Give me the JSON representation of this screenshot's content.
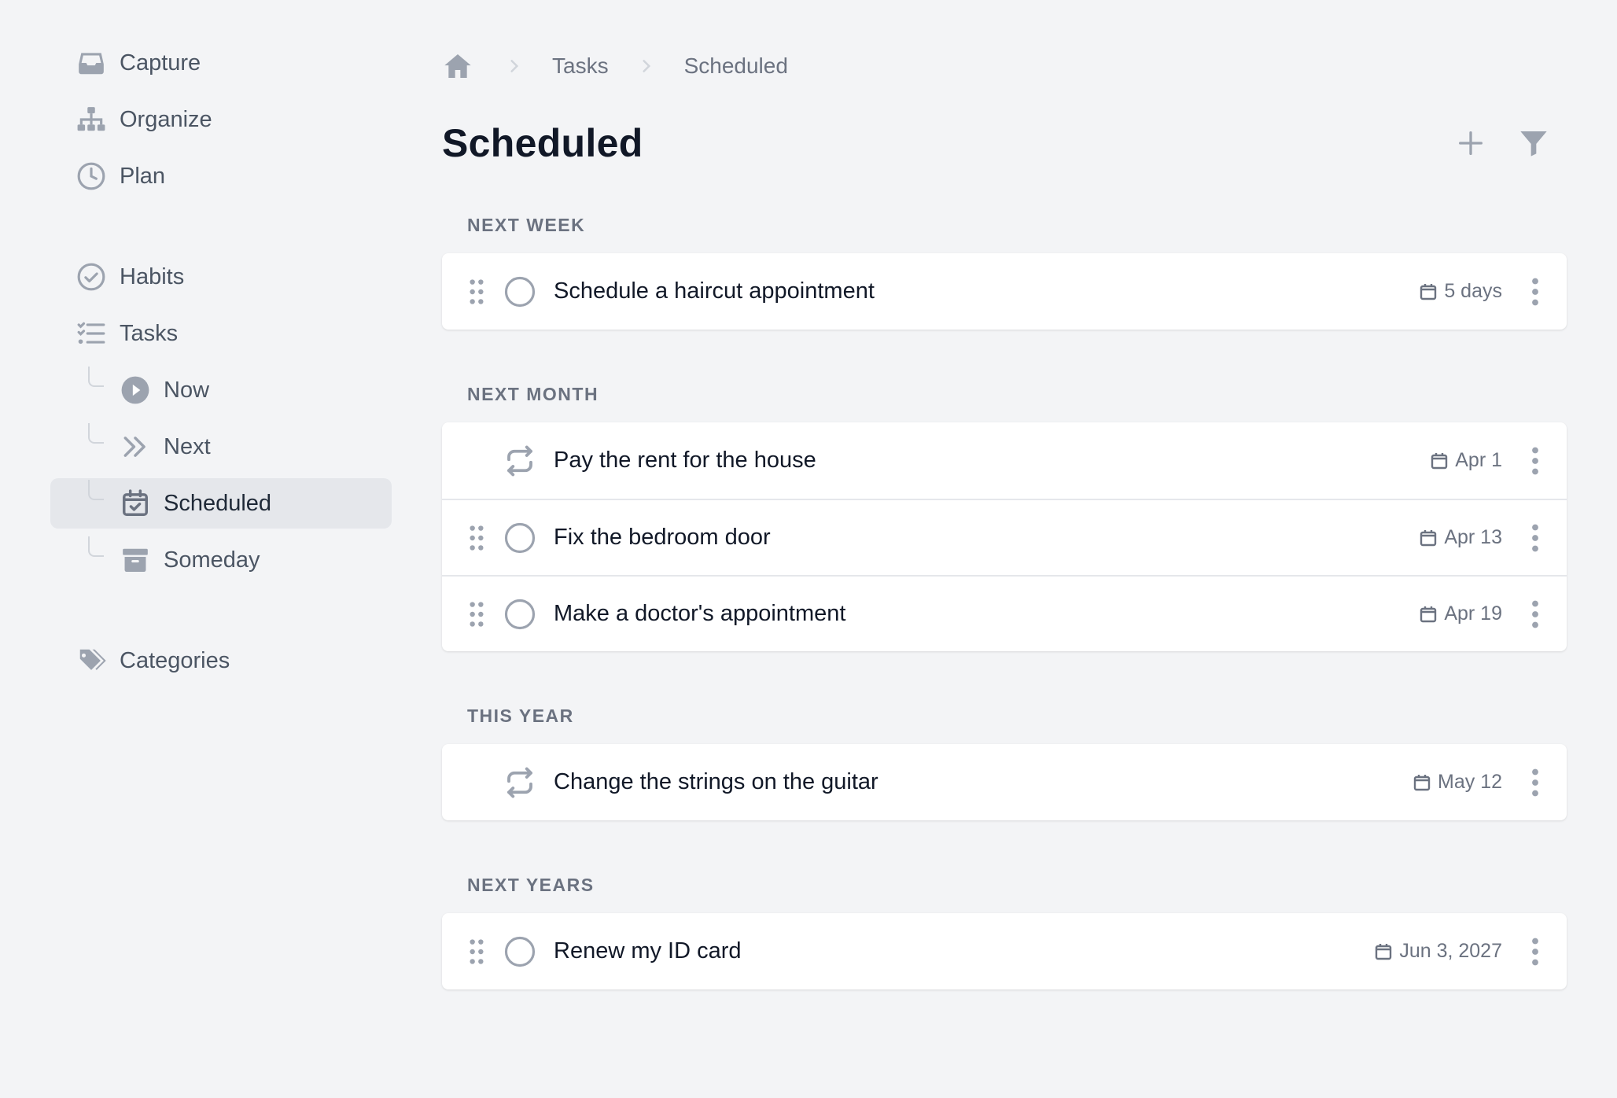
{
  "sidebar": {
    "primary": [
      {
        "label": "Capture",
        "icon": "inbox-icon"
      },
      {
        "label": "Organize",
        "icon": "sitemap-icon"
      },
      {
        "label": "Plan",
        "icon": "clock-icon"
      }
    ],
    "secondary": [
      {
        "label": "Habits",
        "icon": "check-circle-icon"
      },
      {
        "label": "Tasks",
        "icon": "list-check-icon"
      }
    ],
    "task_children": [
      {
        "label": "Now",
        "icon": "play-circle-icon"
      },
      {
        "label": "Next",
        "icon": "double-chevron-right-icon"
      },
      {
        "label": "Scheduled",
        "icon": "calendar-check-icon",
        "active": true
      },
      {
        "label": "Someday",
        "icon": "archive-icon"
      }
    ],
    "tertiary": [
      {
        "label": "Categories",
        "icon": "tags-icon"
      }
    ]
  },
  "breadcrumb": {
    "home_icon": "home-icon",
    "items": [
      "Tasks",
      "Scheduled"
    ]
  },
  "page": {
    "title": "Scheduled"
  },
  "groups": [
    {
      "label": "NEXT WEEK",
      "tasks": [
        {
          "text": "Schedule a haircut appointment",
          "due": "5 days",
          "recurring": false
        }
      ]
    },
    {
      "label": "NEXT MONTH",
      "tasks": [
        {
          "text": "Pay the rent for the house",
          "due": "Apr 1",
          "recurring": true
        },
        {
          "text": "Fix the bedroom door",
          "due": "Apr 13",
          "recurring": false
        },
        {
          "text": "Make a doctor's appointment",
          "due": "Apr 19",
          "recurring": false
        }
      ]
    },
    {
      "label": "THIS YEAR",
      "tasks": [
        {
          "text": "Change the strings on the guitar",
          "due": "May 12",
          "recurring": true
        }
      ]
    },
    {
      "label": "NEXT YEARS",
      "tasks": [
        {
          "text": "Renew my ID card",
          "due": "Jun 3, 2027",
          "recurring": false
        }
      ]
    }
  ],
  "colors": {
    "background": "#f3f4f6",
    "card": "#ffffff",
    "icon_muted": "#9ca3af",
    "text_primary": "#111827",
    "text_secondary": "#6b7280",
    "active_bg": "#e5e7eb"
  }
}
